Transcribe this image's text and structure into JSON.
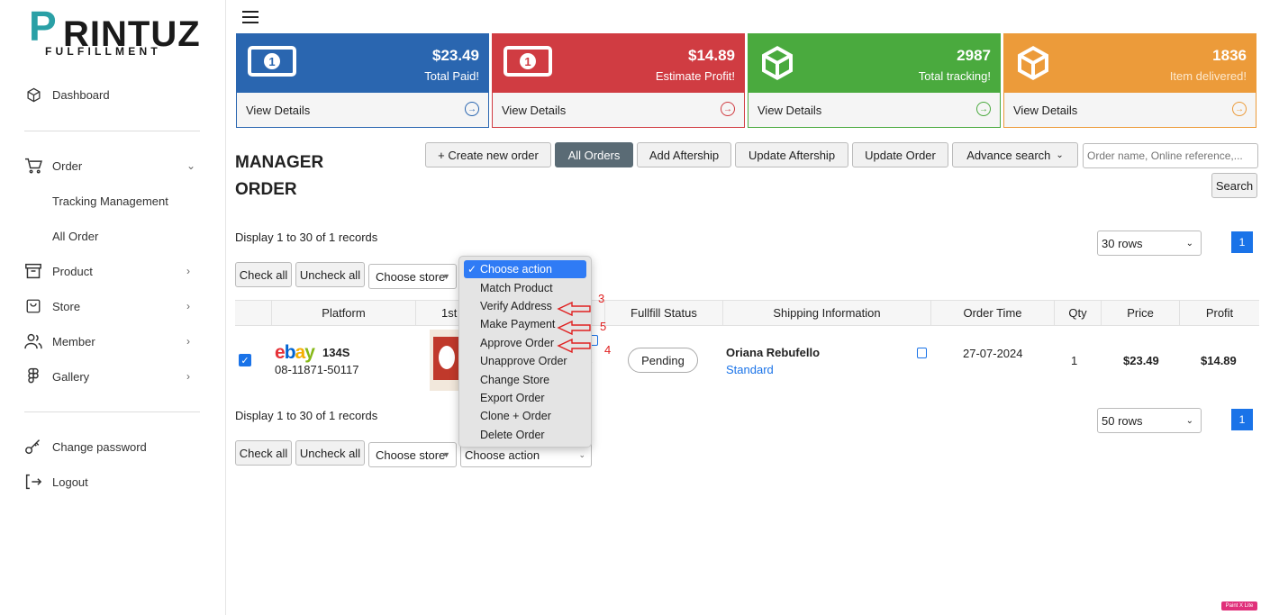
{
  "brand": {
    "logo_p": "P",
    "logo_rest": "RINTUZ",
    "logo_sub": "FULFILLMENT"
  },
  "sidebar": {
    "dashboard": "Dashboard",
    "order": "Order",
    "tracking": "Tracking Management",
    "all_order": "All Order",
    "product": "Product",
    "store": "Store",
    "member": "Member",
    "gallery": "Gallery",
    "change_password": "Change password",
    "logout": "Logout"
  },
  "cards": [
    {
      "amount": "$23.49",
      "label": "Total Paid!",
      "link": "View Details",
      "color": "#2a66b0"
    },
    {
      "amount": "$14.89",
      "label": "Estimate Profit!",
      "link": "View Details",
      "color": "#d03c42"
    },
    {
      "amount": "2987",
      "label": "Total tracking!",
      "link": "View Details",
      "color": "#4aaa3e"
    },
    {
      "amount": "1836",
      "label": "Item delivered!",
      "link": "View Details",
      "color": "#ec9b3a"
    }
  ],
  "page": {
    "title_line1": "MANAGER",
    "title_line2": "ORDER"
  },
  "toolbar": {
    "create": "+ Create new order",
    "all_orders": "All Orders",
    "add_aftership": "Add Aftership",
    "update_aftership": "Update Aftership",
    "update_order": "Update Order",
    "advance_search": "Advance search",
    "search_placeholder": "Order name, Online reference,...",
    "search": "Search"
  },
  "listing": {
    "records_top": "Display 1 to 30 of 1 records",
    "records_bottom": "Display 1 to 30 of 1 records",
    "rows_top": "30 rows",
    "rows_bottom": "50 rows",
    "page": "1",
    "check_all": "Check all",
    "uncheck_all": "Uncheck all",
    "choose_store": "Choose store",
    "choose_action": "Choose action"
  },
  "table": {
    "headers": [
      "Platform",
      "1st I",
      "Fullfill Status",
      "Shipping Information",
      "Order Time",
      "Qty",
      "Price",
      "Profit"
    ],
    "row": {
      "store_code": "134S",
      "order_number": "08-11871-50117",
      "partial_text": "S",
      "status": "Pending",
      "customer": "Oriana Rebufello",
      "shipping": "Standard",
      "order_time": "27-07-2024",
      "qty": "1",
      "price": "$23.49",
      "profit": "$14.89"
    }
  },
  "action_menu": {
    "items": [
      "Choose action",
      "Match Product",
      "Verify Address",
      "Make Payment",
      "Approve Order",
      "Unapprove Order",
      "Change Store",
      "Export Order",
      "Clone + Order",
      "Delete Order"
    ],
    "selected": "Choose action"
  },
  "annotations": {
    "verify": "3",
    "payment": "5",
    "approve": "4"
  },
  "watermark": "Paint X Lite"
}
